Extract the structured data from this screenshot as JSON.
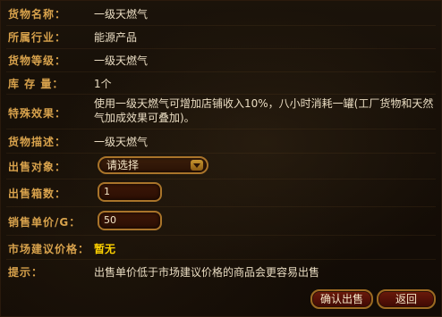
{
  "fields": {
    "goods_name": {
      "label": "货物名称：",
      "value": "一级天燃气"
    },
    "industry": {
      "label": "所属行业：",
      "value": "能源产品"
    },
    "grade": {
      "label": "货物等级：",
      "value": "一级天燃气"
    },
    "stock": {
      "label": "库 存 量：",
      "value": "1个"
    },
    "special_effect": {
      "label": "特殊效果：",
      "value": "使用一级天燃气可增加店铺收入10%，八小时消耗一罐(工厂货物和天然气加成效果可叠加)。"
    },
    "description": {
      "label": "货物描述：",
      "value": "一级天燃气"
    },
    "sale_target": {
      "label": "出售对象：",
      "selected": "请选择"
    },
    "box_count": {
      "label": "出售箱数：",
      "value": "1"
    },
    "unit_price": {
      "label": "销售单价/G：",
      "value": "50"
    },
    "suggested_price": {
      "label": "市场建议价格：",
      "value": "暂无"
    },
    "tip": {
      "label": "提示：",
      "value": "出售单价低于市场建议价格的商品会更容易出售"
    }
  },
  "buttons": {
    "confirm": "确认出售",
    "back": "返回"
  },
  "colors": {
    "label": "#d8a24c",
    "value": "#e9dcc2",
    "highlight": "#ffd200",
    "border": "#a9742a"
  }
}
